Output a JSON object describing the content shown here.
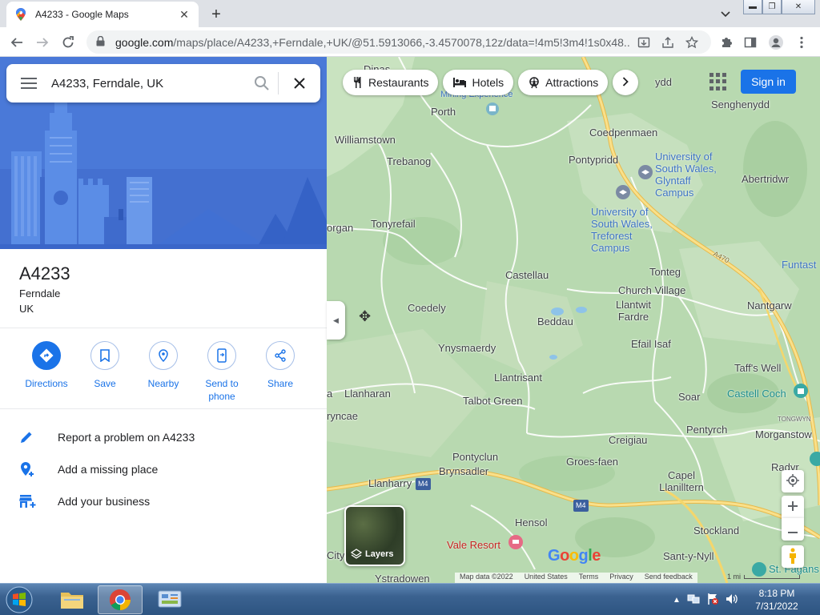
{
  "browser": {
    "tab_title": "A4233 - Google Maps",
    "url_host": "google.com",
    "url_path": "/maps/place/A4233,+Ferndale,+UK/@51.5913066,-3.4570078,12z/data=!4m5!3m4!1s0x48..."
  },
  "search": {
    "query": "A4233, Ferndale, UK"
  },
  "place": {
    "name": "A4233",
    "line1": "Ferndale",
    "line2": "UK"
  },
  "actions": [
    {
      "label": "Directions"
    },
    {
      "label": "Save"
    },
    {
      "label": "Nearby"
    },
    {
      "label": "Send to phone"
    },
    {
      "label": "Share"
    }
  ],
  "links": [
    {
      "label": "Report a problem on A4233"
    },
    {
      "label": "Add a missing place"
    },
    {
      "label": "Add your business"
    }
  ],
  "map": {
    "chips": [
      {
        "label": "Restaurants"
      },
      {
        "label": "Hotels"
      },
      {
        "label": "Attractions"
      }
    ],
    "signin": "Sign in",
    "layers": "Layers",
    "google": "Google",
    "attribution": [
      "Map data ©2022",
      "United States",
      "Terms",
      "Privacy",
      "Send feedback"
    ],
    "scale": "1 mi",
    "towns": {
      "dinas": "Dinas",
      "ydd": "ydd",
      "porth": "Porth",
      "senghenydd": "Senghenydd",
      "mining": "Mining Experience",
      "coedpenmaen": "Coedpenmaen",
      "williamstown": "Williamstown",
      "trebanog": "Trebanog",
      "pontypridd": "Pontypridd",
      "uni1": "University of South Wales, Glyntaff Campus",
      "abertridwr": "Abertridwr",
      "uni2": "University of South Wales, Treforest Campus",
      "tonyrefail": "Tonyrefail",
      "organ": "organ",
      "a470": "A470",
      "funtast": "Funtast",
      "castellau": "Castellau",
      "tonteg": "Tonteg",
      "church_village": "Church Village",
      "coedely": "Coedely",
      "llantwit": "Llantwit Fardre",
      "nantgarw": "Nantgarw",
      "beddau": "Beddau",
      "efail_isaf": "Efail Isaf",
      "ynysmaerdy": "Ynysmaerdy",
      "taffs_well": "Taff's Well",
      "llantrisant": "Llantrisant",
      "llanharan": "Llanharan",
      "a": "a",
      "talbot_green": "Talbot Green",
      "soar": "Soar",
      "castell_coch": "Castell Coch",
      "ryncae": "ryncae",
      "tongwyn": "TONGWYN",
      "pentyrch": "Pentyrch",
      "morganstown": "Morganstow",
      "creigiau": "Creigiau",
      "pontyclun": "Pontyclun",
      "brynsadler": "Brynsadler",
      "groes_faen": "Groes-faen",
      "radyr": "Radyr",
      "capel": "Capel Llanilltern",
      "llanharry": "Llanharry",
      "m4a": "M4",
      "m4b": "M4",
      "hensol": "Hensol",
      "stockland": "Stockland",
      "vale_resort": "Vale Resort",
      "city": "City",
      "santynyll": "Sant-y-Nyll",
      "ystradowen": "Ystradowen",
      "st_fagans": "St. Fagans"
    }
  },
  "taskbar": {
    "time": "8:18 PM",
    "date": "7/31/2022"
  },
  "colors": {
    "accent": "#1a73e8",
    "map_green": "#b8d9b0",
    "road_yellow": "#f5d66b"
  }
}
